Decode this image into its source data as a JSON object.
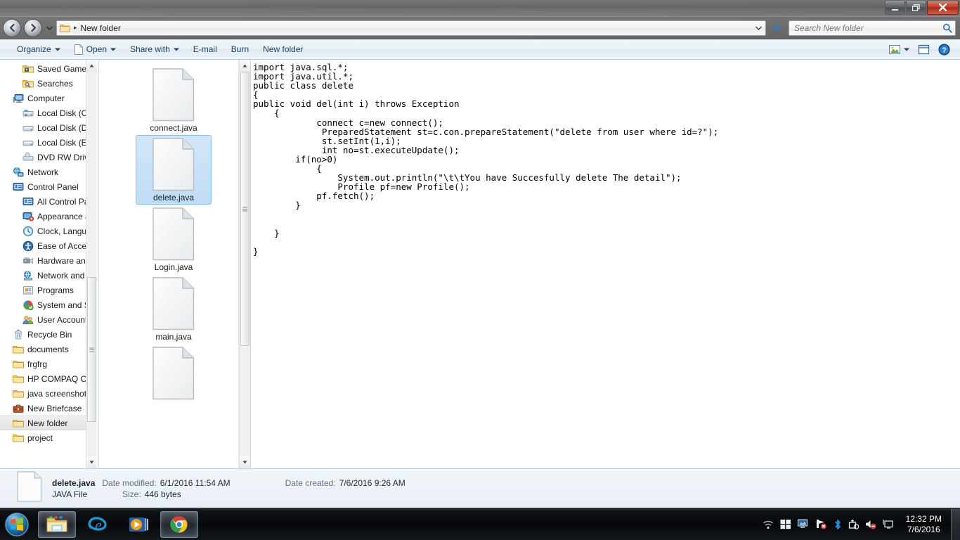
{
  "window": {
    "title": "New folder",
    "controls": {
      "minimize": "Minimize",
      "restore": "Restore",
      "close": "Close"
    }
  },
  "address": {
    "folder_icon": "folder-icon",
    "separator": "▸",
    "path_label": "New folder",
    "dropdown_icon": "chevron-down-icon",
    "refresh_icon": "refresh-icon",
    "back_icon": "back-arrow-icon",
    "forward_icon": "forward-arrow-icon",
    "history_icon": "chevron-down-icon"
  },
  "search": {
    "placeholder": "Search New folder",
    "value": "",
    "icon": "search-icon"
  },
  "toolbar": {
    "items": [
      {
        "label": "Organize",
        "caret": true,
        "icon": null
      },
      {
        "label": "Open",
        "caret": true,
        "icon": "file-icon"
      },
      {
        "label": "Share with",
        "caret": true,
        "icon": null
      },
      {
        "label": "E-mail",
        "caret": false,
        "icon": null
      },
      {
        "label": "Burn",
        "caret": false,
        "icon": null
      },
      {
        "label": "New folder",
        "caret": false,
        "icon": null
      }
    ],
    "view_button": "change-view-icon",
    "view_caret": "chevron-down-icon",
    "preview_button": "preview-pane-icon",
    "help_button": "help-icon"
  },
  "navigation": {
    "items": [
      {
        "label": "Saved Games",
        "icon": "saved-games-folder-icon",
        "indent": 2,
        "selected": false
      },
      {
        "label": "Searches",
        "icon": "searches-folder-icon",
        "indent": 2,
        "selected": false
      },
      {
        "label": "Computer",
        "icon": "computer-icon",
        "indent": 1,
        "selected": false
      },
      {
        "label": "Local Disk (C:)",
        "icon": "system-drive-icon",
        "indent": 2,
        "selected": false
      },
      {
        "label": "Local Disk (D:)",
        "icon": "drive-icon",
        "indent": 2,
        "selected": false
      },
      {
        "label": "Local Disk (E:)",
        "icon": "drive-icon",
        "indent": 2,
        "selected": false
      },
      {
        "label": "DVD RW Drive (",
        "icon": "dvd-drive-icon",
        "indent": 2,
        "selected": false
      },
      {
        "label": "Network",
        "icon": "network-icon",
        "indent": 1,
        "selected": false
      },
      {
        "label": "Control Panel",
        "icon": "control-panel-icon",
        "indent": 1,
        "selected": false
      },
      {
        "label": "All Control Pan",
        "icon": "control-panel-icon",
        "indent": 2,
        "selected": false
      },
      {
        "label": "Appearance an",
        "icon": "appearance-icon",
        "indent": 2,
        "selected": false
      },
      {
        "label": "Clock, Languag",
        "icon": "clock-language-icon",
        "indent": 2,
        "selected": false
      },
      {
        "label": "Ease of Access",
        "icon": "ease-of-access-icon",
        "indent": 2,
        "selected": false
      },
      {
        "label": "Hardware and ",
        "icon": "hardware-sound-icon",
        "indent": 2,
        "selected": false
      },
      {
        "label": "Network and In",
        "icon": "network-internet-icon",
        "indent": 2,
        "selected": false
      },
      {
        "label": "Programs",
        "icon": "programs-icon",
        "indent": 2,
        "selected": false
      },
      {
        "label": "System and Sec",
        "icon": "system-security-icon",
        "indent": 2,
        "selected": false
      },
      {
        "label": "User Accounts",
        "icon": "user-accounts-icon",
        "indent": 2,
        "selected": false
      },
      {
        "label": "Recycle Bin",
        "icon": "recycle-bin-icon",
        "indent": 1,
        "selected": false
      },
      {
        "label": "documents",
        "icon": "folder-icon",
        "indent": 1,
        "selected": false
      },
      {
        "label": "frgfrg",
        "icon": "folder-icon",
        "indent": 1,
        "selected": false
      },
      {
        "label": "HP COMPAQ CQ",
        "icon": "folder-icon",
        "indent": 1,
        "selected": false
      },
      {
        "label": "java screenshots",
        "icon": "folder-icon",
        "indent": 1,
        "selected": false
      },
      {
        "label": "New Briefcase",
        "icon": "briefcase-icon",
        "indent": 1,
        "selected": false
      },
      {
        "label": "New folder",
        "icon": "folder-icon",
        "indent": 1,
        "selected": true
      },
      {
        "label": "project",
        "icon": "folder-icon",
        "indent": 1,
        "selected": false
      }
    ]
  },
  "files": {
    "items": [
      {
        "name": "connect.java",
        "icon": "generic-file-icon",
        "selected": false
      },
      {
        "name": "delete.java",
        "icon": "generic-file-icon",
        "selected": true
      },
      {
        "name": "Login.java",
        "icon": "generic-file-icon",
        "selected": false
      },
      {
        "name": "main.java",
        "icon": "generic-file-icon",
        "selected": false
      },
      {
        "name": "",
        "icon": "generic-file-icon",
        "selected": false
      }
    ]
  },
  "preview": {
    "code": "import java.sql.*;\nimport java.util.*;\npublic class delete\n{\npublic void del(int i) throws Exception\n    {\n            connect c=new connect();\n             PreparedStatement st=c.con.prepareStatement(\"delete from user where id=?\");\n             st.setInt(1,i);\n             int no=st.executeUpdate();\n        if(no>0)\n            {\n                System.out.println(\"\\t\\tYou have Succesfully delete The detail\");\n                Profile pf=new Profile();\n            pf.fetch();\n        }\n\n\n    }\n\n}"
  },
  "details": {
    "file_name": "delete.java",
    "date_modified_key": "Date modified:",
    "date_modified_value": "6/1/2016 11:54 AM",
    "date_created_key": "Date created:",
    "date_created_value": "7/6/2016 9:26 AM",
    "file_type": "JAVA File",
    "size_key": "Size:",
    "size_value": "446 bytes",
    "icon": "generic-file-icon"
  },
  "taskbar": {
    "start_button": "start-orb-icon",
    "tasks": [
      {
        "name": "windows-explorer-taskbar-icon",
        "active": true
      },
      {
        "name": "internet-explorer-taskbar-icon",
        "active": false
      },
      {
        "name": "windows-media-player-taskbar-icon",
        "active": false
      },
      {
        "name": "google-chrome-taskbar-icon",
        "active": true
      }
    ],
    "tray": [
      "wifi-icon",
      "windows-flag-icon",
      "network-monitor-icon",
      "network-error-icon",
      "bluetooth-icon",
      "safely-remove-hardware-icon",
      "volume-muted-icon",
      "display-icon"
    ],
    "clock_time": "12:32 PM",
    "clock_date": "7/6/2016",
    "show_desktop": "show-desktop-button"
  },
  "colors": {
    "selection_blue": "#bfdcf5",
    "toolbar_text": "#1d3f5e",
    "close_red": "#bc3b2c"
  }
}
